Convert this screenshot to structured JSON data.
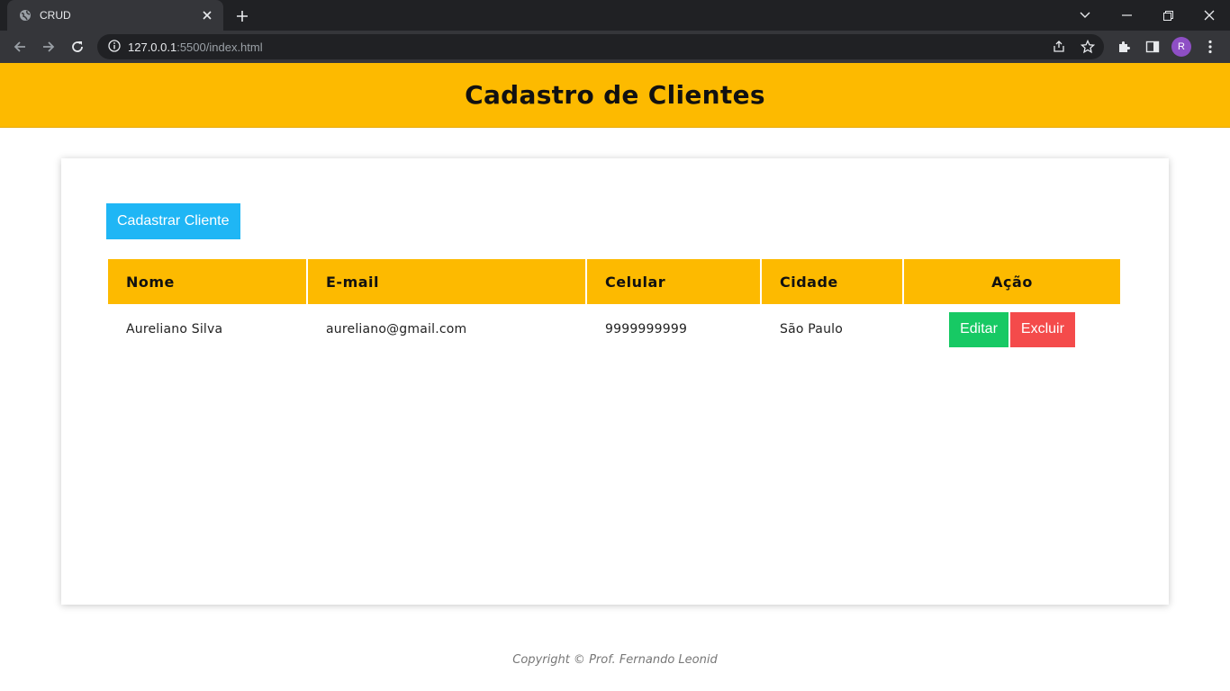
{
  "browser": {
    "tab_title": "CRUD",
    "url_host": "127.0.0.1",
    "url_rest": ":5500/index.html",
    "avatar_letter": "R"
  },
  "app": {
    "title": "Cadastro de Clientes",
    "add_button": "Cadastrar Cliente",
    "table": {
      "headers": [
        "Nome",
        "E-mail",
        "Celular",
        "Cidade",
        "Ação"
      ],
      "rows": [
        {
          "nome": "Aureliano Silva",
          "email": "aureliano@gmail.com",
          "celular": "9999999999",
          "cidade": "São Paulo",
          "edit_label": "Editar",
          "delete_label": "Excluir"
        }
      ]
    },
    "footer": "Copyright © Prof. Fernando Leonid"
  },
  "colors": {
    "brand": "#fdba00",
    "primary": "#1fb6f5",
    "success": "#17c964",
    "danger": "#f44b4b"
  }
}
